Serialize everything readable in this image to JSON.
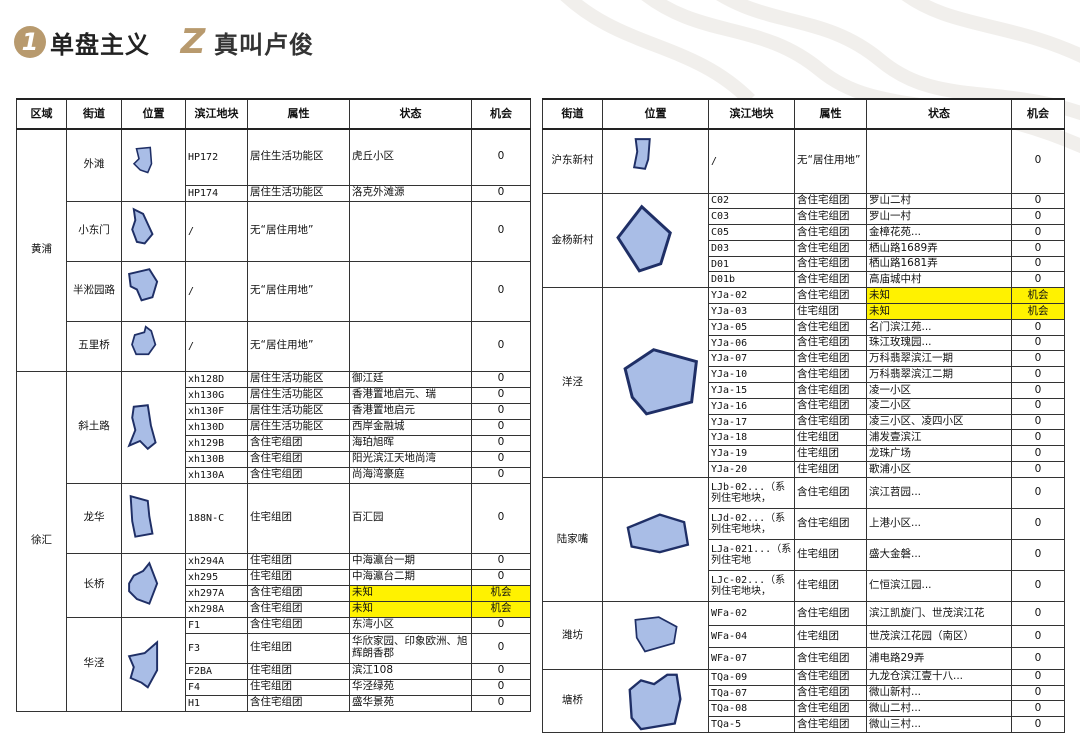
{
  "header": {
    "step1_num": "1",
    "step1_title": "单盘主义",
    "step2_num": "Z",
    "step2_title": "真叫卢俊"
  },
  "left_table": {
    "headers": [
      "区域",
      "街道",
      "位置",
      "滨江地块",
      "属性",
      "状态",
      "机会"
    ],
    "districts": [
      {
        "name": "黄浦",
        "streets": [
          {
            "name": "外滩",
            "rows": [
              {
                "plot": "HP172",
                "attr": "居住生活功能区",
                "status": "虎丘小区",
                "opp": "0"
              },
              {
                "plot": "HP174",
                "attr": "居住生活功能区",
                "status": "洛克外滩源",
                "opp": "0"
              }
            ]
          },
          {
            "name": "小东门",
            "rows": [
              {
                "plot": "/",
                "attr": "无“居住用地”",
                "status": "",
                "opp": "0"
              }
            ]
          },
          {
            "name": "半淞园路",
            "rows": [
              {
                "plot": "/",
                "attr": "无“居住用地”",
                "status": "",
                "opp": "0"
              }
            ]
          },
          {
            "name": "五里桥",
            "rows": [
              {
                "plot": "/",
                "attr": "无“居住用地”",
                "status": "",
                "opp": "0"
              }
            ]
          }
        ]
      },
      {
        "name": "徐汇",
        "streets": [
          {
            "name": "斜土路",
            "rows": [
              {
                "plot": "xh128D",
                "attr": "居住生活功能区",
                "status": "御江廷",
                "opp": "0"
              },
              {
                "plot": "xh130G",
                "attr": "居住生活功能区",
                "status": "香港置地启元、瑞",
                "opp": "0"
              },
              {
                "plot": "xh130F",
                "attr": "居住生活功能区",
                "status": "香港置地启元",
                "opp": "0"
              },
              {
                "plot": "xh130D",
                "attr": "居住生活功能区",
                "status": "西岸金融城",
                "opp": "0"
              },
              {
                "plot": "xh129B",
                "attr": "含住宅组团",
                "status": "海珀旭晖",
                "opp": "0"
              },
              {
                "plot": "xh130B",
                "attr": "含住宅组团",
                "status": "阳光滨江天地尚湾",
                "opp": "0"
              },
              {
                "plot": "xh130A",
                "attr": "含住宅组团",
                "status": "尚海湾豪庭",
                "opp": "0"
              }
            ]
          },
          {
            "name": "龙华",
            "rows": [
              {
                "plot": "188N-C",
                "attr": "住宅组团",
                "status": "百汇园",
                "opp": "0"
              }
            ]
          },
          {
            "name": "长桥",
            "rows": [
              {
                "plot": "xh294A",
                "attr": "住宅组团",
                "status": "中海瀛台一期",
                "opp": "0"
              },
              {
                "plot": "xh295",
                "attr": "住宅组团",
                "status": "中海瀛台二期",
                "opp": "0"
              },
              {
                "plot": "xh297A",
                "attr": "含住宅组团",
                "status": "未知",
                "opp": "机会"
              },
              {
                "plot": "xh298A",
                "attr": "含住宅组团",
                "status": "未知",
                "opp": "机会"
              }
            ]
          },
          {
            "name": "华泾",
            "rows": [
              {
                "plot": "F1",
                "attr": "含住宅组团",
                "status": "东湾小区",
                "opp": "0"
              },
              {
                "plot": "F3",
                "attr": "住宅组团",
                "status": "华欣家园、印象欧洲、旭辉朗香郡",
                "opp": "0"
              },
              {
                "plot": "F2BA",
                "attr": "住宅组团",
                "status": "滨江108",
                "opp": "0"
              },
              {
                "plot": "F4",
                "attr": "住宅组团",
                "status": "华泾绿苑",
                "opp": "0"
              },
              {
                "plot": "H1",
                "attr": "含住宅组团",
                "status": "盛华景苑",
                "opp": "0"
              }
            ]
          }
        ]
      }
    ]
  },
  "right_table": {
    "headers": [
      "街道",
      "位置",
      "滨江地块",
      "属性",
      "状态",
      "机会"
    ],
    "streets": [
      {
        "name": "沪东新村",
        "rows": [
          {
            "plot": "/",
            "attr": "无“居住用地”",
            "status": "",
            "opp": "0"
          }
        ]
      },
      {
        "name": "金杨新村",
        "rows": [
          {
            "plot": "C02",
            "attr": "含住宅组团",
            "status": "罗山二村",
            "opp": "0"
          },
          {
            "plot": "C03",
            "attr": "含住宅组团",
            "status": "罗山一村",
            "opp": "0"
          },
          {
            "plot": "C05",
            "attr": "含住宅组团",
            "status": "金樟花苑...",
            "opp": "0"
          },
          {
            "plot": "D03",
            "attr": "含住宅组团",
            "status": "栖山路1689弄",
            "opp": "0"
          },
          {
            "plot": "D01",
            "attr": "含住宅组团",
            "status": "栖山路1681弄",
            "opp": "0"
          },
          {
            "plot": "D01b",
            "attr": "含住宅组团",
            "status": "高庙城中村",
            "opp": "0"
          }
        ]
      },
      {
        "name": "洋泾",
        "rows": [
          {
            "plot": "YJa-02",
            "attr": "含住宅组团",
            "status": "未知",
            "opp": "机会"
          },
          {
            "plot": "YJa-03",
            "attr": "住宅组团",
            "status": "未知",
            "opp": "机会"
          },
          {
            "plot": "YJa-05",
            "attr": "含住宅组团",
            "status": "名门滨江苑...",
            "opp": "0"
          },
          {
            "plot": "YJa-06",
            "attr": "含住宅组团",
            "status": "珠江玫瑰园...",
            "opp": "0"
          },
          {
            "plot": "YJa-07",
            "attr": "含住宅组团",
            "status": "万科翡翠滨江一期",
            "opp": "0"
          },
          {
            "plot": "YJa-10",
            "attr": "含住宅组团",
            "status": "万科翡翠滨江二期",
            "opp": "0"
          },
          {
            "plot": "YJa-15",
            "attr": "含住宅组团",
            "status": "凌一小区",
            "opp": "0"
          },
          {
            "plot": "YJa-16",
            "attr": "含住宅组团",
            "status": "凌二小区",
            "opp": "0"
          },
          {
            "plot": "YJa-17",
            "attr": "含住宅组团",
            "status": "凌三小区、凌四小区",
            "opp": "0"
          },
          {
            "plot": "YJa-18",
            "attr": "住宅组团",
            "status": "浦发壹滨江",
            "opp": "0"
          },
          {
            "plot": "YJa-19",
            "attr": "住宅组团",
            "status": "龙珠广场",
            "opp": "0"
          },
          {
            "plot": "YJa-20",
            "attr": "住宅组团",
            "status": "歌浦小区",
            "opp": "0"
          }
        ]
      },
      {
        "name": "陆家嘴",
        "rows": [
          {
            "plot": "LJb-02...（系列住宅地块，",
            "attr": "含住宅组团",
            "status": "滨江苕园...",
            "opp": "0"
          },
          {
            "plot": "LJd-02...（系列住宅地块，",
            "attr": "含住宅组团",
            "status": "上港小区...",
            "opp": "0"
          },
          {
            "plot": "LJa-021...（系列住宅地",
            "attr": "住宅组团",
            "status": "盛大金磐...",
            "opp": "0"
          },
          {
            "plot": "LJc-02...（系列住宅地块，",
            "attr": "住宅组团",
            "status": "仁恒滨江园...",
            "opp": "0"
          }
        ]
      },
      {
        "name": "潍坊",
        "rows": [
          {
            "plot": "WFa-02",
            "attr": "含住宅组团",
            "status": "滨江凯旋门、世茂滨江花",
            "opp": "0"
          },
          {
            "plot": "WFa-04",
            "attr": "住宅组团",
            "status": "世茂滨江花园（南区）",
            "opp": "0"
          },
          {
            "plot": "WFa-07",
            "attr": "含住宅组团",
            "status": "浦电路29弄",
            "opp": "0"
          }
        ]
      },
      {
        "name": "塘桥",
        "rows": [
          {
            "plot": "TQa-09",
            "attr": "含住宅组团",
            "status": "九龙仓滨江壹十八...",
            "opp": "0"
          },
          {
            "plot": "TQa-07",
            "attr": "含住宅组团",
            "status": "微山新村...",
            "opp": "0"
          },
          {
            "plot": "TQa-08",
            "attr": "含住宅组团",
            "status": "微山二村...",
            "opp": "0"
          },
          {
            "plot": "TQa-5",
            "attr": "含住宅组团",
            "status": "微山三村...",
            "opp": "0"
          }
        ]
      }
    ]
  },
  "colors": {
    "highlight": "#fff200",
    "shape_fill": "#a9bde6",
    "shape_stroke": "#1f2f66",
    "brand": "#b89a6e"
  },
  "icons": [
    "district-map-shape-icon"
  ]
}
